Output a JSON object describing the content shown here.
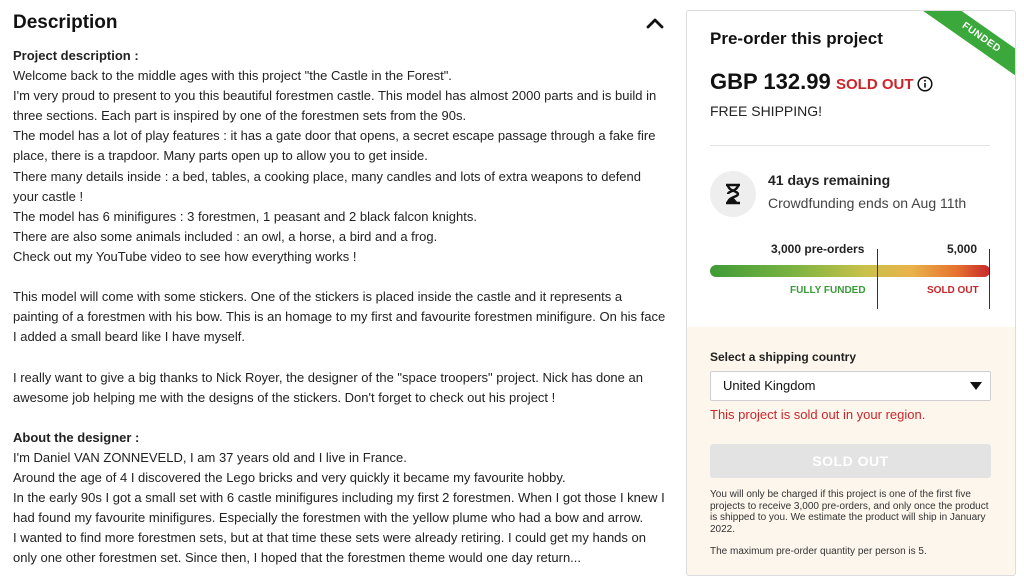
{
  "description": {
    "title": "Description",
    "paragraphs": [
      {
        "text": "Project description :",
        "bold": true
      },
      {
        "text": "Welcome back to the middle ages with this project \"the Castle in the Forest\"."
      },
      {
        "text": "I'm very proud to present to you this beautiful forestmen castle. This model has almost 2000 parts and is build in three sections. Each part is inspired by one of the forestmen sets from the 90s."
      },
      {
        "text": "The model has a lot of play features : it has a gate door that opens, a secret escape passage through a fake fire place, there is a trapdoor. Many parts open up to allow you to get inside."
      },
      {
        "text": "There many details inside : a bed, tables, a cooking place, many candles and lots of extra weapons to defend your castle !"
      },
      {
        "text": "The model has 6 minifigures : 3 forestmen, 1 peasant and 2 black falcon knights."
      },
      {
        "text": "There are also some animals included : an owl, a horse, a bird and a frog."
      },
      {
        "text": "Check out my YouTube video to see how everything works !"
      },
      {
        "text": "",
        "gap": true
      },
      {
        "text": "This model will come with some stickers. One of the stickers is placed inside the castle and it represents a painting of a forestmen with his bow. This is an homage to my first and favourite forestmen minifigure. On his face I added a small beard like I have myself."
      },
      {
        "text": "",
        "gap": true
      },
      {
        "text": "I really want to give a big thanks to Nick Royer, the designer of the \"space troopers\" project. Nick has done an awesome job helping me with the designs of the stickers. Don't forget to check out his project !"
      },
      {
        "text": "",
        "gap": true
      },
      {
        "text": "About the designer :",
        "bold": true
      },
      {
        "text": "I'm Daniel VAN ZONNEVELD, I am 37 years old and I live in France."
      },
      {
        "text": "Around the age of 4 I discovered the Lego bricks and very quickly it became my favourite hobby."
      },
      {
        "text": "In the early 90s I got a small set with 6 castle minifigures including my first 2 forestmen. When I got those I knew I had found my favourite minifigures. Especially the forestmen with the yellow plume who had a bow and arrow."
      },
      {
        "text": "I wanted to find more forestmen sets, but at that time these sets were already retiring. I could get my hands on only one other forestmen set. Since then, I hoped that the forestmen theme would one day return..."
      }
    ]
  },
  "card": {
    "ribbon": "FUNDED",
    "title": "Pre-order this project",
    "price": "GBP 132.99",
    "sold_out_tag": "SOLD OUT",
    "shipping": "FREE SHIPPING!",
    "days_remaining": "41 days remaining",
    "ends": "Crowdfunding ends on Aug 11th",
    "preorders": "3,000 pre-orders",
    "max": "5,000",
    "fully_funded": "FULLY FUNDED",
    "sold_out_label": "SOLD OUT",
    "ship_label": "Select a shipping country",
    "country": "United Kingdom",
    "region_msg": "This project is sold out in your region.",
    "button": "SOLD OUT",
    "notice": "You will only be charged if this project is one of the first five projects to receive 3,000 pre-orders, and only once the product is shipped to you. We estimate the product will ship in January 2022.",
    "max_note": "The maximum pre-order quantity per person is 5."
  },
  "colors": {
    "accent_red": "#c8262b",
    "funded_green": "#3aa83a"
  }
}
